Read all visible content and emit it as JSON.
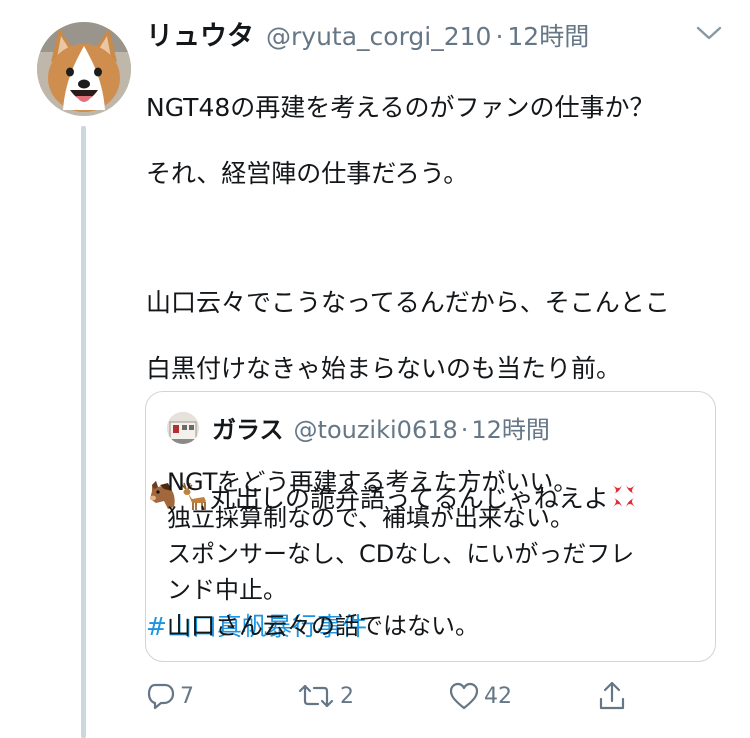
{
  "tweet": {
    "display_name": "リュウタ",
    "handle": "@ryuta_corgi_210",
    "separator": "·",
    "time": "12時間",
    "lines": [
      "NGT48の再建を考えるのがファンの仕事か？",
      "それ、経営陣の仕事だろう。",
      "山口云々でこうなってるんだから、そこんとこ",
      "白黒付けなきゃ始まらないのも当たり前。"
    ],
    "emoji_line": {
      "leading_emoji": [
        "horse-face-emoji",
        "deer-emoji"
      ],
      "text": "丸出しの詭弁語ってるんじゃねえよ",
      "trailing_emoji": "anger-symbol-emoji"
    },
    "hashtag": "#山口真帆暴行事件"
  },
  "quoted_tweet": {
    "display_name": "ガラス",
    "handle": "@touziki0618",
    "separator": "·",
    "time": "12時間",
    "lines": [
      "NGTをどう再建する考えた方がいい。",
      "独立採算制なので、補填が出来ない。",
      "スポンサーなし、CDなし、にいがっだフレ",
      "ンド中止。",
      "山口さん云々の話ではない。"
    ]
  },
  "actions": {
    "reply_count": "7",
    "retweet_count": "2",
    "like_count": "42",
    "share_count": ""
  },
  "colors": {
    "text": "#14171a",
    "secondary": "#657786",
    "link": "#1b95e0",
    "border": "#ccd6dd"
  }
}
